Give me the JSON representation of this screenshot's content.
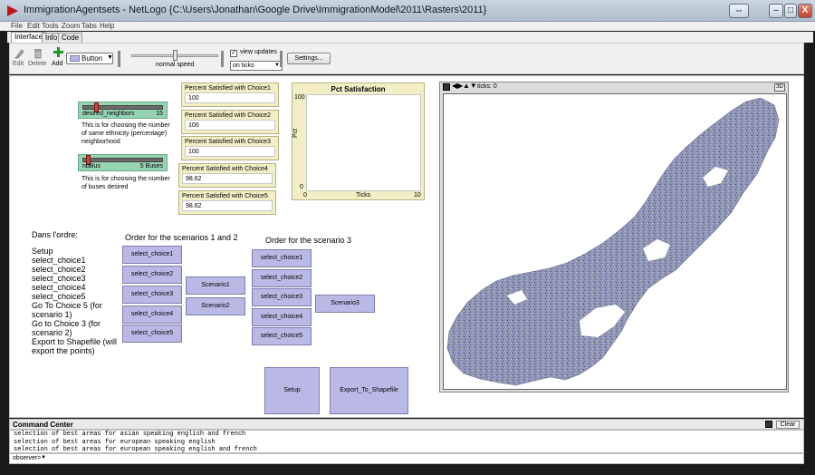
{
  "window": {
    "title": "ImmigrationAgentsets - NetLogo {C:\\Users\\Jonathan\\Google Drive\\ImmigrationModel\\2011\\Rasters\\2011}",
    "controls": {
      "restore": "⇔",
      "minimize": "–",
      "maximize": "□",
      "close": "X"
    }
  },
  "menu": [
    "File",
    "Edit",
    "Tools",
    "Zoom",
    "Tabs",
    "Help"
  ],
  "tabs": [
    "Interface",
    "Info",
    "Code"
  ],
  "toolbar": {
    "edit": "Edit",
    "delete": "Delete",
    "add": "Add",
    "widget_type": "Button",
    "speed_label": "normal speed",
    "view_updates": "view updates",
    "view_updates_checked": true,
    "update_mode": "on ticks",
    "settings": "Settings..."
  },
  "sliders": [
    {
      "name": "desired_neighbors",
      "value": "15",
      "level": 0.15,
      "note": "This is for choosing the number of same ethnicity (percentage) neighborhood"
    },
    {
      "name": "nbBus",
      "value": "5 Buses",
      "level": 0.05,
      "note": "This is for choosing the number of buses desired"
    }
  ],
  "monitors": [
    {
      "label": "Percent Satisfied with Choice1",
      "value": "100"
    },
    {
      "label": "Percent Satisfied with Choice2",
      "value": "100"
    },
    {
      "label": "Percent Satisfied with Choice3",
      "value": "100"
    },
    {
      "label": "Percent Satisfied with Choice4",
      "value": "98.62"
    },
    {
      "label": "Percent Satisfied with Choice5",
      "value": "98.62"
    }
  ],
  "plot": {
    "title": "Pct Satisfaction",
    "ylabel": "Pct",
    "xlabel": "Ticks",
    "ymax": "100",
    "ymin": "0",
    "xmin": "0",
    "xmax": "10"
  },
  "instructions": {
    "heading": "Dans l'ordre:",
    "lines": [
      "Setup",
      "select_choice1",
      "select_choice2",
      "select_choice3",
      "select_choice4",
      "select_choice5",
      "Go To Choice 5 (for",
      "scenario 1)",
      "Go to Choice 3 (for",
      "scenario 2)",
      "Export to Shapefile (will",
      "export the points)"
    ]
  },
  "scenario12": {
    "heading": "Order for the scenarios 1 and 2",
    "choices": [
      "select_choice1",
      "select_choice2",
      "select_choice3",
      "select_choice4",
      "select_choice5"
    ],
    "scenarios": [
      "Scenario1",
      "Scenario2"
    ]
  },
  "scenario3": {
    "heading": "Order for the scenario 3",
    "choices": [
      "select_choice1",
      "select_choice2",
      "select_choice3",
      "select_choice4",
      "select_choice5"
    ],
    "scenario": "Scenario3"
  },
  "actions": {
    "setup": "Setup",
    "export": "Export_To_Shapefile"
  },
  "view": {
    "ticks_label": "ticks: 0",
    "mode_3d": "3D"
  },
  "command_center": {
    "title": "Command Center",
    "clear": "Clear",
    "output": [
      "selection of best areas for asian speaking english and french",
      "selection of best areas for european speaking english",
      "selection of best areas for european speaking english and french"
    ],
    "prompt": "observer>"
  },
  "colors": {
    "slider": "#96d4b4",
    "monitor": "#f2efc6",
    "button": "#bab9e6",
    "map_fill": "#8f95b8"
  }
}
